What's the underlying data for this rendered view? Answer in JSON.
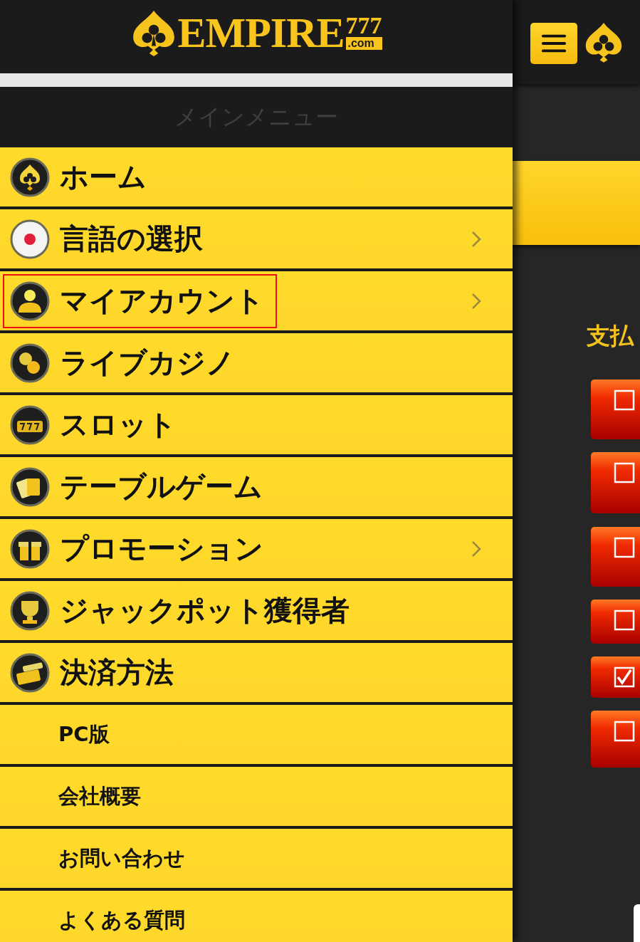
{
  "drawer": {
    "logo": {
      "name": "EMPIRE",
      "number": "777",
      "domain": ".com"
    },
    "menu_title": "メインメニュー",
    "items": [
      {
        "label": "ホーム",
        "submenu": false,
        "highlighted": false,
        "kind": "main"
      },
      {
        "label": "言語の選択",
        "submenu": true,
        "highlighted": false,
        "kind": "main"
      },
      {
        "label": "マイアカウント",
        "submenu": true,
        "highlighted": true,
        "kind": "main"
      },
      {
        "label": "ライブカジノ",
        "submenu": false,
        "highlighted": false,
        "kind": "main"
      },
      {
        "label": "スロット",
        "submenu": false,
        "highlighted": false,
        "kind": "main"
      },
      {
        "label": "テーブルゲーム",
        "submenu": false,
        "highlighted": false,
        "kind": "main"
      },
      {
        "label": "プロモーション",
        "submenu": true,
        "highlighted": false,
        "kind": "main"
      },
      {
        "label": "ジャックポット獲得者",
        "submenu": false,
        "highlighted": false,
        "kind": "main"
      },
      {
        "label": "決済方法",
        "submenu": false,
        "highlighted": false,
        "kind": "main"
      },
      {
        "label": "PC版",
        "kind": "sub"
      },
      {
        "label": "会社概要",
        "kind": "sub"
      },
      {
        "label": "お問い合わせ",
        "kind": "sub"
      },
      {
        "label": "よくある質問",
        "kind": "sub"
      }
    ]
  },
  "page": {
    "section_title": "支払",
    "options": [
      {
        "checked": false
      },
      {
        "checked": false
      },
      {
        "checked": false
      },
      {
        "checked": false
      },
      {
        "checked": true
      },
      {
        "checked": false
      }
    ]
  }
}
